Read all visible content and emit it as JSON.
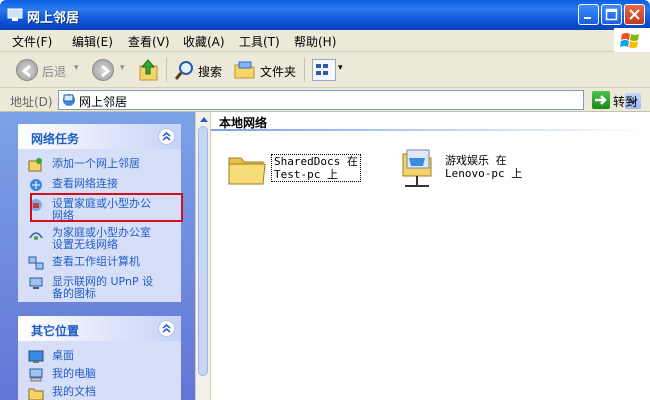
{
  "window": {
    "title": "网上邻居",
    "icons": [
      "network-places-icon",
      "minimize-icon",
      "maximize-icon",
      "close-icon"
    ]
  },
  "menu": {
    "items": [
      "文件(F)",
      "编辑(E)",
      "查看(V)",
      "收藏(A)",
      "工具(T)",
      "帮助(H)"
    ]
  },
  "toolbar": {
    "back_label": "后退",
    "search_label": "搜索",
    "folders_label": "文件夹"
  },
  "address": {
    "label": "地址(D)",
    "value": "网上邻居",
    "go_label": "转到"
  },
  "network_tasks": {
    "title": "网络任务",
    "items": [
      {
        "label": "添加一个网上邻居",
        "icon": "add-network-place-icon"
      },
      {
        "label": "查看网络连接",
        "icon": "network-connections-icon"
      },
      {
        "label": "设置家庭或小型办公\n网络",
        "icon": "home-network-setup-icon"
      },
      {
        "label": "为家庭或小型办公室\n设置无线网络",
        "icon": "wireless-network-icon"
      },
      {
        "label": "查看工作组计算机",
        "icon": "workgroup-computers-icon"
      },
      {
        "label": "显示联网的 UPnP 设\n备的图标",
        "icon": "upnp-device-icon"
      }
    ]
  },
  "other_places": {
    "title": "其它位置",
    "items": [
      {
        "label": "桌面",
        "icon": "desktop-icon"
      },
      {
        "label": "我的电脑",
        "icon": "my-computer-icon"
      },
      {
        "label": "我的文档",
        "icon": "my-documents-icon"
      }
    ]
  },
  "content": {
    "group_title": "本地网络",
    "items": [
      {
        "label": "SharedDocs 在\nTest-pc 上",
        "icon": "shared-folder-icon"
      },
      {
        "label": "游戏娱乐 在\nLenovo-pc 上",
        "icon": "network-share-icon"
      }
    ]
  },
  "colors": {
    "titlebar": "#0a5fe0",
    "task_link": "#215dc6",
    "highlight_border": "#d01020",
    "left_pane": "#7ba2e7"
  }
}
